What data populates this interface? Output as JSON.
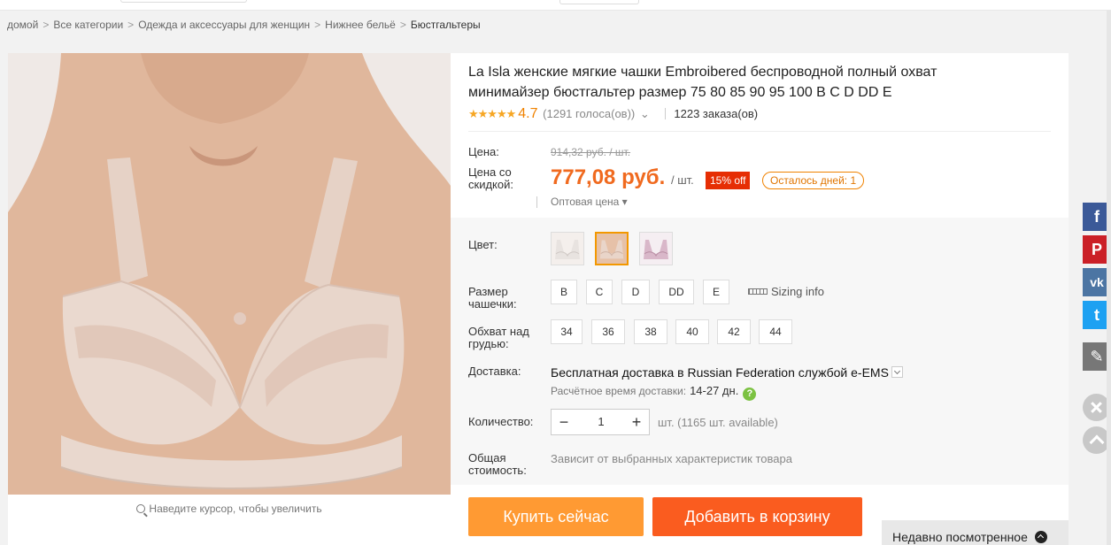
{
  "breadcrumb": {
    "items": [
      "домой",
      "Все категории",
      "Одежда и аксессуары для женщин",
      "Нижнее бельё"
    ],
    "current": "Бюстгальтеры",
    "separator": ">"
  },
  "gallery": {
    "zoom_hint": "Наведите курсор, чтобы увеличить"
  },
  "product": {
    "title": "La Isla женские мягкие чашки Embroibered беспроводной полный охват минимайзер бюстгальтер размер 75 80 85 90 95 100 B C D DD E",
    "stars": "★★★★★",
    "rating": "4.7",
    "votes": "(1291 голоса(ов))",
    "orders": "1223 заказа(ов)"
  },
  "price": {
    "label": "Цена:",
    "old": "914,32 руб. / шт.",
    "discount_label": "Цена со скидкой:",
    "new": "777,08 руб.",
    "unit": "/ шт.",
    "off_badge": "15% off",
    "days_left": "Осталось дней: 1",
    "wholesale": "Оптовая цена ▾"
  },
  "options": {
    "color_label": "Цвет:",
    "cup_label": "Размер чашечки:",
    "cup_sizes": [
      "B",
      "C",
      "D",
      "DD",
      "E"
    ],
    "sizing_info": "Sizing info",
    "band_label": "Обхват над грудью:",
    "band_sizes": [
      "34",
      "36",
      "38",
      "40",
      "42",
      "44"
    ]
  },
  "shipping": {
    "label": "Доставка:",
    "text": "Бесплатная доставка в Russian Federation службой e-EMS",
    "eta_label": "Расчётное время доставки:",
    "eta": "14-27 дн.",
    "help": "?"
  },
  "quantity": {
    "label": "Количество:",
    "minus": "−",
    "value": "1",
    "plus": "+",
    "available": "шт. (1165 шт. available)"
  },
  "total": {
    "label": "Общая стоимость:",
    "value": "Зависит от выбранных характеристик товара"
  },
  "actions": {
    "buy_now": "Купить сейчас",
    "add_to_cart": "Добавить в корзину"
  },
  "recent": {
    "label": "Недавно посмотренное"
  },
  "social": {
    "facebook": "f",
    "pinterest": "P",
    "vk": "vk",
    "twitter": "t",
    "edit": "✎"
  },
  "colors": {
    "accent": "#f06a1f",
    "buy": "#ff9a33",
    "cart": "#fa5c1f",
    "off_badge": "#e62e04",
    "stars": "#f6a623"
  }
}
